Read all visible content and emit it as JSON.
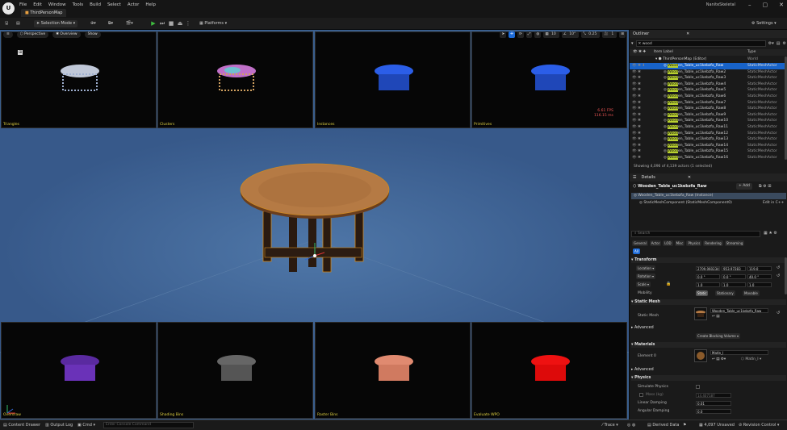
{
  "app": {
    "project_name": "NaniteSkeletal",
    "doc_tab": "ThirdPersonMap",
    "logo": "U"
  },
  "menu": [
    "File",
    "Edit",
    "Window",
    "Tools",
    "Build",
    "Select",
    "Actor",
    "Help"
  ],
  "window_controls": [
    "–",
    "▢",
    "✕"
  ],
  "toolbar": {
    "selection_mode": "Selection Mode",
    "platforms": "Platforms",
    "settings": "Settings"
  },
  "viewport": {
    "perspective": "Perspective",
    "overview": "Overview",
    "show": "Show",
    "right_controls": [
      "10",
      "10°",
      "0.25",
      "1"
    ],
    "fps": "6.61 FPS",
    "ms": "116.15 ms",
    "panes": {
      "triangles": "Triangles",
      "clusters": "Clusters",
      "instances": "Instances",
      "primitives": "Primitives",
      "overdraw": "Overdraw",
      "shading_bins": "Shading Bins",
      "raster_bins": "Raster Bins",
      "evaluate_wpo": "Evaluate WPO"
    }
  },
  "outliner": {
    "title": "Outliner",
    "search_value": "wood",
    "col_item": "Item Label",
    "col_type": "Type",
    "map_row": {
      "name": "ThirdPersonMap (Editor)",
      "type": "World"
    },
    "rows": [
      {
        "pre": "Wood",
        "post": "en_Table_uc1kebzfa_Raw",
        "type": "StaticMeshActor"
      },
      {
        "pre": "Wood",
        "post": "en_Table_uc1kebzfa_Raw2",
        "type": "StaticMeshActor"
      },
      {
        "pre": "Wood",
        "post": "en_Table_uc1kebzfa_Raw3",
        "type": "StaticMeshActor"
      },
      {
        "pre": "Wood",
        "post": "en_Table_uc1kebzfa_Raw4",
        "type": "StaticMeshActor"
      },
      {
        "pre": "Wood",
        "post": "en_Table_uc1kebzfa_Raw5",
        "type": "StaticMeshActor"
      },
      {
        "pre": "Wood",
        "post": "en_Table_uc1kebzfa_Raw6",
        "type": "StaticMeshActor"
      },
      {
        "pre": "Wood",
        "post": "en_Table_uc1kebzfa_Raw7",
        "type": "StaticMeshActor"
      },
      {
        "pre": "Wood",
        "post": "en_Table_uc1kebzfa_Raw8",
        "type": "StaticMeshActor"
      },
      {
        "pre": "Wood",
        "post": "en_Table_uc1kebzfa_Raw9",
        "type": "StaticMeshActor"
      },
      {
        "pre": "Wood",
        "post": "en_Table_uc1kebzfa_Raw10",
        "type": "StaticMeshActor"
      },
      {
        "pre": "Wood",
        "post": "en_Table_uc1kebzfa_Raw11",
        "type": "StaticMeshActor"
      },
      {
        "pre": "Wood",
        "post": "en_Table_uc1kebzfa_Raw12",
        "type": "StaticMeshActor"
      },
      {
        "pre": "Wood",
        "post": "en_Table_uc1kebzfa_Raw13",
        "type": "StaticMeshActor"
      },
      {
        "pre": "Wood",
        "post": "en_Table_uc1kebzfa_Raw14",
        "type": "StaticMeshActor"
      },
      {
        "pre": "Wood",
        "post": "en_Table_uc1kebzfa_Raw15",
        "type": "StaticMeshActor"
      },
      {
        "pre": "Wood",
        "post": "en_Table_uc1kebzfa_Raw16",
        "type": "StaticMeshActor"
      }
    ],
    "status": "Showing 4,096 of 4,139 actors (1 selected)"
  },
  "details": {
    "title": "Details",
    "actor_name": "Wooden_Table_uc1kebzfa_Raw",
    "add_label": "+ Add",
    "instance_row": "Wooden_Table_uc1kebzfa_Raw (Instance)",
    "component_row": "StaticMeshComponent (StaticMeshComponent0)",
    "edit_cpp": "Edit in C++",
    "search_placeholder": "Search",
    "tabs": [
      "General",
      "Actor",
      "LOD",
      "Misc",
      "Physics",
      "Rendering",
      "Streaming",
      "All"
    ],
    "transform": "Transform",
    "location": {
      "label": "Location",
      "x": "2709.060234",
      "y": "953.97283",
      "z": "119.0"
    },
    "rotation": {
      "label": "Rotation",
      "x": "0.0 °",
      "y": "0.0 °",
      "z": "40.0 °"
    },
    "scale": {
      "label": "Scale",
      "x": "1.0",
      "y": "1.0",
      "z": "1.0"
    },
    "mobility": {
      "label": "Mobility",
      "options": [
        "Static",
        "Stationary",
        "Movable"
      ]
    },
    "static_mesh_section": "Static Mesh",
    "static_mesh_label": "Static Mesh",
    "static_mesh_value": "Wooden_Table_uc1kebzfa_Raw",
    "advanced": "Advanced",
    "create_blocking": "Create Blocking Volume",
    "materials_section": "Materials",
    "element_label": "Element 0",
    "material_value": "MatIn_I",
    "material_tag": "MatIn_I",
    "advanced2": "Advanced",
    "physics_section": "Physics",
    "simulate_physics": "Simulate Physics",
    "mass_kg": "Mass (kg)",
    "mass_value": "14.407187",
    "linear_damping": "Linear Damping",
    "linear_value": "0.01",
    "angular_damping": "Angular Damping",
    "angular_value": "0.0"
  },
  "status_bar": {
    "content_drawer": "Content Drawer",
    "output_log": "Output Log",
    "cmd": "Cmd",
    "console_placeholder": "Enter Console Command",
    "trace": "Trace",
    "derived_data": "Derived Data",
    "unsaved": "4,097 Unsaved",
    "revision_control": "Revision Control"
  }
}
